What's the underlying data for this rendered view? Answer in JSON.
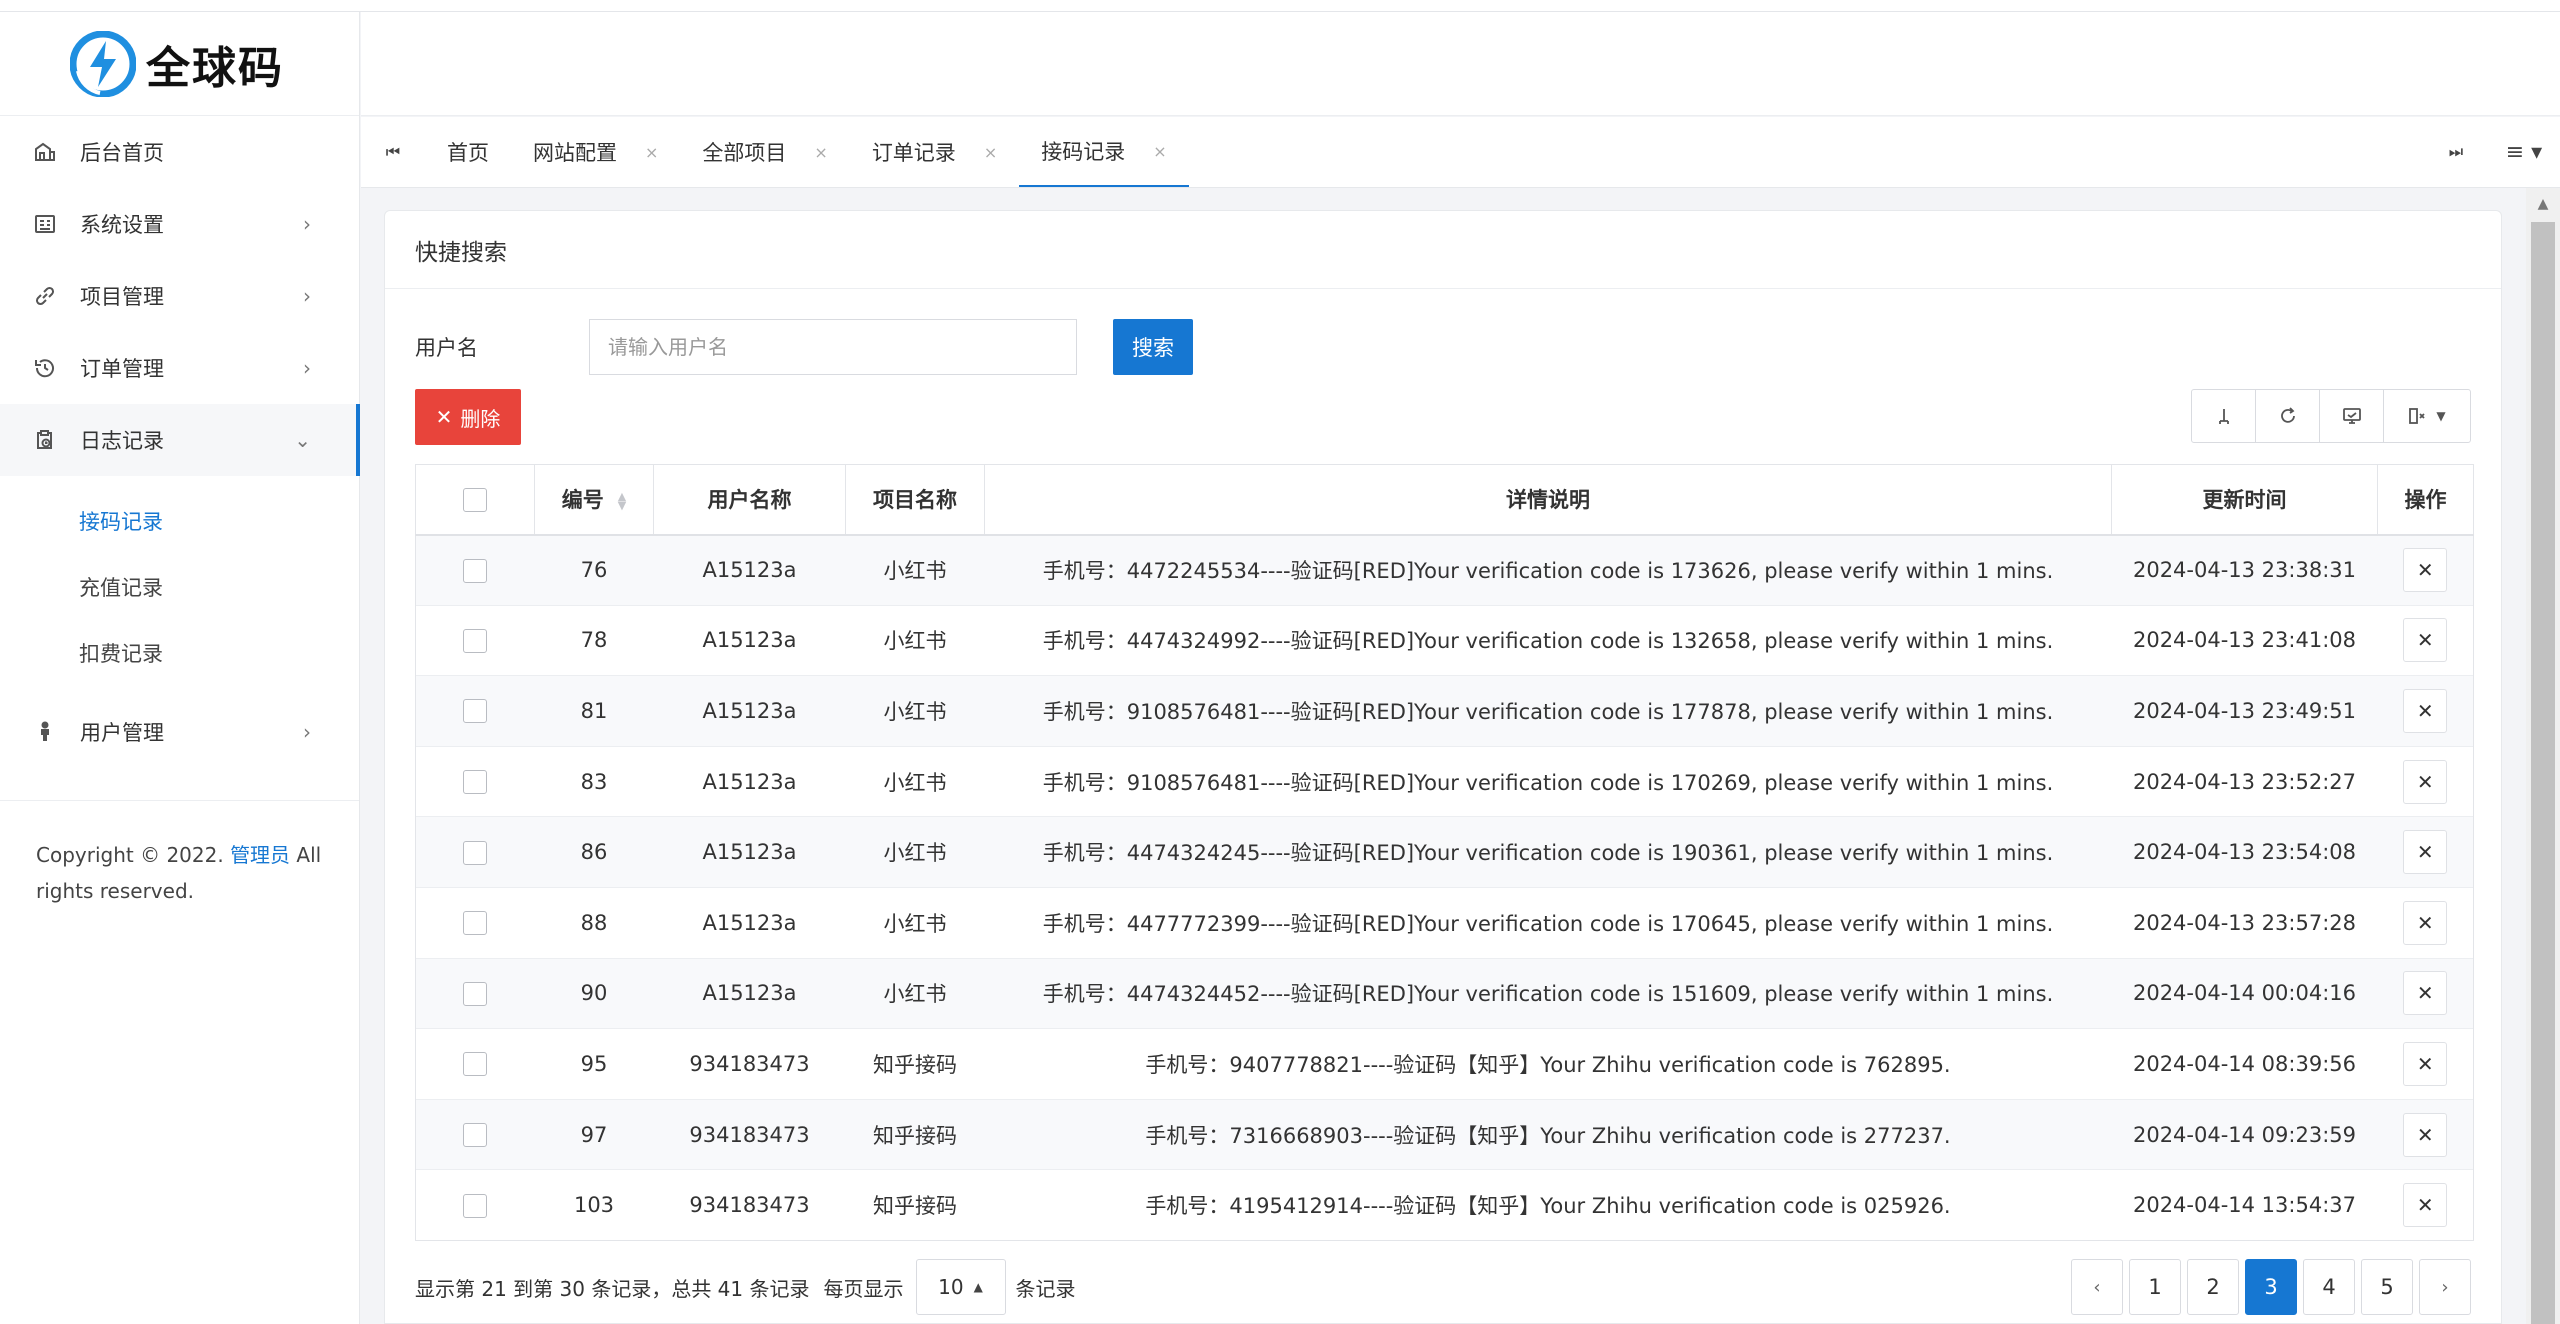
{
  "app": {
    "logo_text": "全球码",
    "brand_color": "#1677d2"
  },
  "sidebar": {
    "items": [
      {
        "label": "后台首页",
        "icon": "home-icon",
        "chevron": ""
      },
      {
        "label": "系统设置",
        "icon": "settings-panel-icon",
        "chevron": "›"
      },
      {
        "label": "项目管理",
        "icon": "link-icon",
        "chevron": "›"
      },
      {
        "label": "订单管理",
        "icon": "history-icon",
        "chevron": "›"
      },
      {
        "label": "日志记录",
        "icon": "clipboard-clock-icon",
        "chevron": "⌄"
      }
    ],
    "sub_items": [
      {
        "label": "接码记录",
        "active": true
      },
      {
        "label": "充值记录",
        "active": false
      },
      {
        "label": "扣费记录",
        "active": false
      }
    ],
    "user_item": {
      "label": "用户管理",
      "icon": "user-icon",
      "chevron": "›"
    },
    "copyright_prefix": "Copyright © 2022.",
    "copyright_link": "管理员",
    "copyright_suffix": "All rights reserved."
  },
  "tabs": {
    "items": [
      {
        "label": "首页",
        "closable": false
      },
      {
        "label": "网站配置",
        "closable": true
      },
      {
        "label": "全部项目",
        "closable": true
      },
      {
        "label": "订单记录",
        "closable": true
      },
      {
        "label": "接码记录",
        "closable": true
      }
    ],
    "close_glyph": "×",
    "prev_glyph": "⏮",
    "next_glyph": "⏭",
    "menu_glyph": "≡ ▾"
  },
  "card": {
    "title": "快捷搜索",
    "search_label": "用户名",
    "search_placeholder": "请输入用户名",
    "search_button": "搜索",
    "delete_button": "删除",
    "delete_glyph": "✕"
  },
  "table": {
    "headers": [
      "",
      "编号",
      "用户名称",
      "项目名称",
      "详情说明",
      "更新时间",
      "操作"
    ],
    "rows": [
      {
        "id": "76",
        "user": "A15123a",
        "project": "小红书",
        "detail": "手机号：4472245534----验证码[RED]Your verification code is 173626, please verify within 1 mins.",
        "time": "2024-04-13 23:38:31"
      },
      {
        "id": "78",
        "user": "A15123a",
        "project": "小红书",
        "detail": "手机号：4474324992----验证码[RED]Your verification code is 132658, please verify within 1 mins.",
        "time": "2024-04-13 23:41:08"
      },
      {
        "id": "81",
        "user": "A15123a",
        "project": "小红书",
        "detail": "手机号：9108576481----验证码[RED]Your verification code is 177878, please verify within 1 mins.",
        "time": "2024-04-13 23:49:51"
      },
      {
        "id": "83",
        "user": "A15123a",
        "project": "小红书",
        "detail": "手机号：9108576481----验证码[RED]Your verification code is 170269, please verify within 1 mins.",
        "time": "2024-04-13 23:52:27"
      },
      {
        "id": "86",
        "user": "A15123a",
        "project": "小红书",
        "detail": "手机号：4474324245----验证码[RED]Your verification code is 190361, please verify within 1 mins.",
        "time": "2024-04-13 23:54:08"
      },
      {
        "id": "88",
        "user": "A15123a",
        "project": "小红书",
        "detail": "手机号：4477772399----验证码[RED]Your verification code is 170645, please verify within 1 mins.",
        "time": "2024-04-13 23:57:28"
      },
      {
        "id": "90",
        "user": "A15123a",
        "project": "小红书",
        "detail": "手机号：4474324452----验证码[RED]Your verification code is 151609, please verify within 1 mins.",
        "time": "2024-04-14 00:04:16"
      },
      {
        "id": "95",
        "user": "934183473",
        "project": "知乎接码",
        "detail": "手机号：9407778821----验证码【知乎】Your Zhihu verification code is 762895.",
        "time": "2024-04-14 08:39:56"
      },
      {
        "id": "97",
        "user": "934183473",
        "project": "知乎接码",
        "detail": "手机号：7316668903----验证码【知乎】Your Zhihu verification code is 277237.",
        "time": "2024-04-14 09:23:59"
      },
      {
        "id": "103",
        "user": "934183473",
        "project": "知乎接码",
        "detail": "手机号：4195412914----验证码【知乎】Your Zhihu verification code is 025926.",
        "time": "2024-04-14 13:54:37"
      }
    ],
    "row_action_glyph": "✕"
  },
  "pagination": {
    "info": "显示第 21 到第 30 条记录，总共 41 条记录",
    "per_page_prefix": "每页显示",
    "per_page_value": "10",
    "per_page_suffix": "条记录",
    "prev_glyph": "‹",
    "next_glyph": "›",
    "pages": [
      "1",
      "2",
      "3",
      "4",
      "5"
    ],
    "current": "3"
  }
}
